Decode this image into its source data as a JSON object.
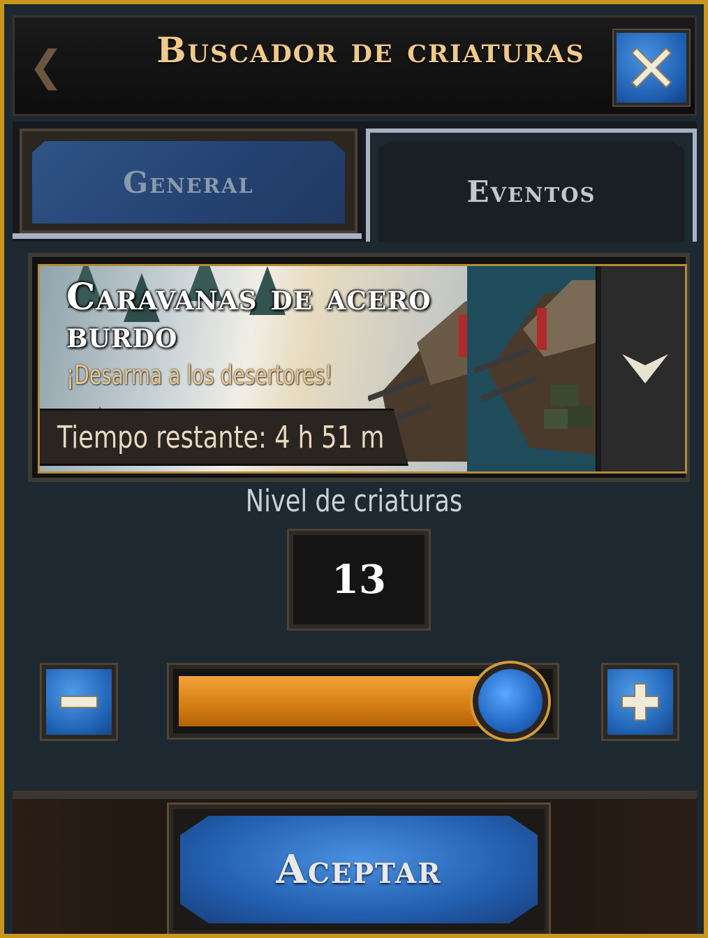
{
  "dialog": {
    "title": "Buscador de criaturas",
    "close_icon": "close-icon"
  },
  "tabs": [
    {
      "label": "General",
      "active": false
    },
    {
      "label": "Eventos",
      "active": true
    }
  ],
  "event": {
    "title": "Caravanas de acero burdo",
    "subtitle": "¡Desarma a los desertores!",
    "time_remaining": "Tiempo restante: 4 h 51 m",
    "dropdown_icon": "chevron-down-icon"
  },
  "level": {
    "label": "Nivel de criaturas",
    "value": "13",
    "slider_fraction": 0.9,
    "minus_icon": "minus-icon",
    "plus_icon": "plus-icon"
  },
  "footer": {
    "accept_label": "Aceptar"
  },
  "colors": {
    "accent_gold": "#f1c98a",
    "button_blue": "#235fb0",
    "slider_orange": "#d47d12"
  }
}
